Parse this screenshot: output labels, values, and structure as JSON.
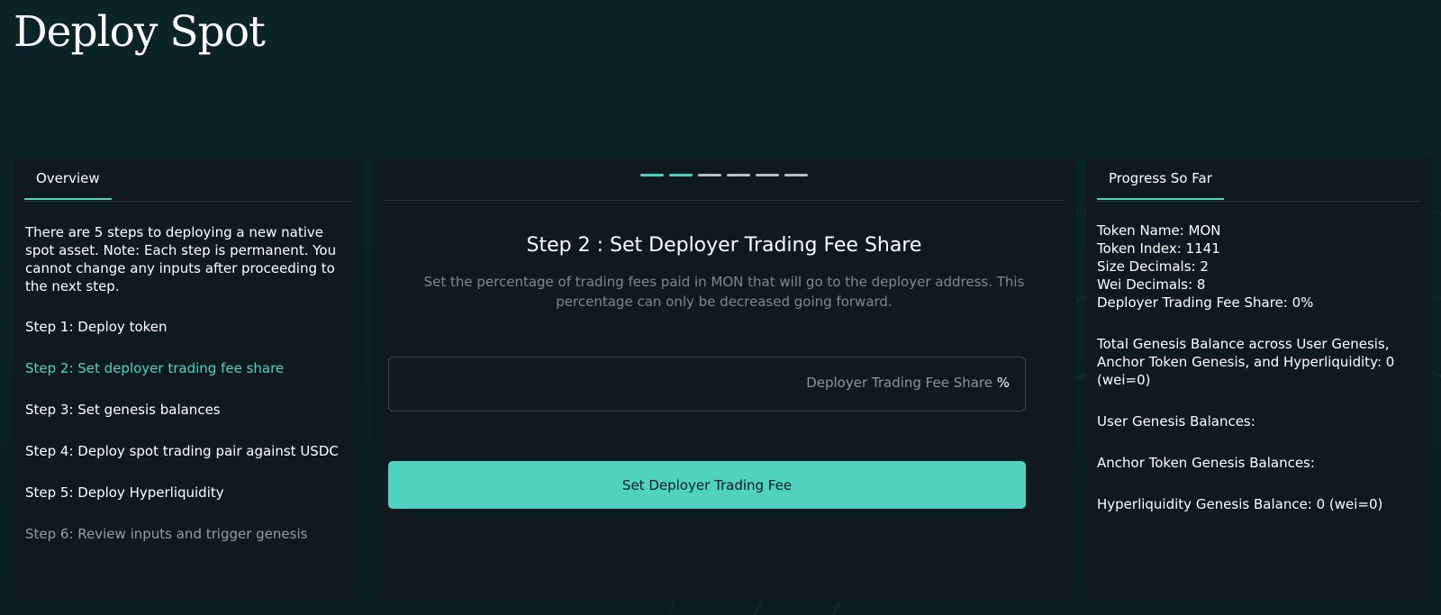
{
  "page": {
    "title": "Deploy Spot"
  },
  "overview": {
    "tab_label": "Overview",
    "intro": "There are 5 steps to deploying a new native spot asset. Note: Each step is permanent. You cannot change any inputs after proceeding to the next step.",
    "steps": [
      {
        "label": "Step 1: Deploy token",
        "state": "done"
      },
      {
        "label": "Step 2: Set deployer trading fee share",
        "state": "active"
      },
      {
        "label": "Step 3: Set genesis balances",
        "state": "done"
      },
      {
        "label": "Step 4: Deploy spot trading pair against USDC",
        "state": "done"
      },
      {
        "label": "Step 5: Deploy Hyperliquidity",
        "state": "done"
      },
      {
        "label": "Step 6: Review inputs and trigger genesis",
        "state": "pending"
      }
    ]
  },
  "wizard": {
    "progress": {
      "completed": 2,
      "total": 6
    },
    "title": "Step 2 : Set Deployer Trading Fee Share",
    "description": "Set the percentage of trading fees paid in MON that will go to the deployer address. This percentage can only be decreased going forward.",
    "fee_input": {
      "value": "",
      "label": "Deployer Trading Fee Share",
      "unit": "%"
    },
    "submit_label": "Set Deployer Trading Fee"
  },
  "progress_so_far": {
    "tab_label": "Progress So Far",
    "token_name": "Token Name: MON",
    "token_index": "Token Index: 1141",
    "size_decimals": "Size Decimals: 2",
    "wei_decimals": "Wei Decimals: 8",
    "fee_share": "Deployer Trading Fee Share: 0%",
    "total_genesis": "Total Genesis Balance across User Genesis, Anchor Token Genesis, and Hyperliquidity: 0 (wei=0)",
    "user_genesis": "User Genesis Balances:",
    "anchor_genesis": "Anchor Token Genesis Balances:",
    "hyperliquidity_genesis": "Hyperliquidity Genesis Balance: 0 (wei=0)"
  },
  "colors": {
    "accent": "#50d2c1",
    "background": "#0a2024",
    "panel": "#0f1a20",
    "muted_text": "#949e9c"
  }
}
